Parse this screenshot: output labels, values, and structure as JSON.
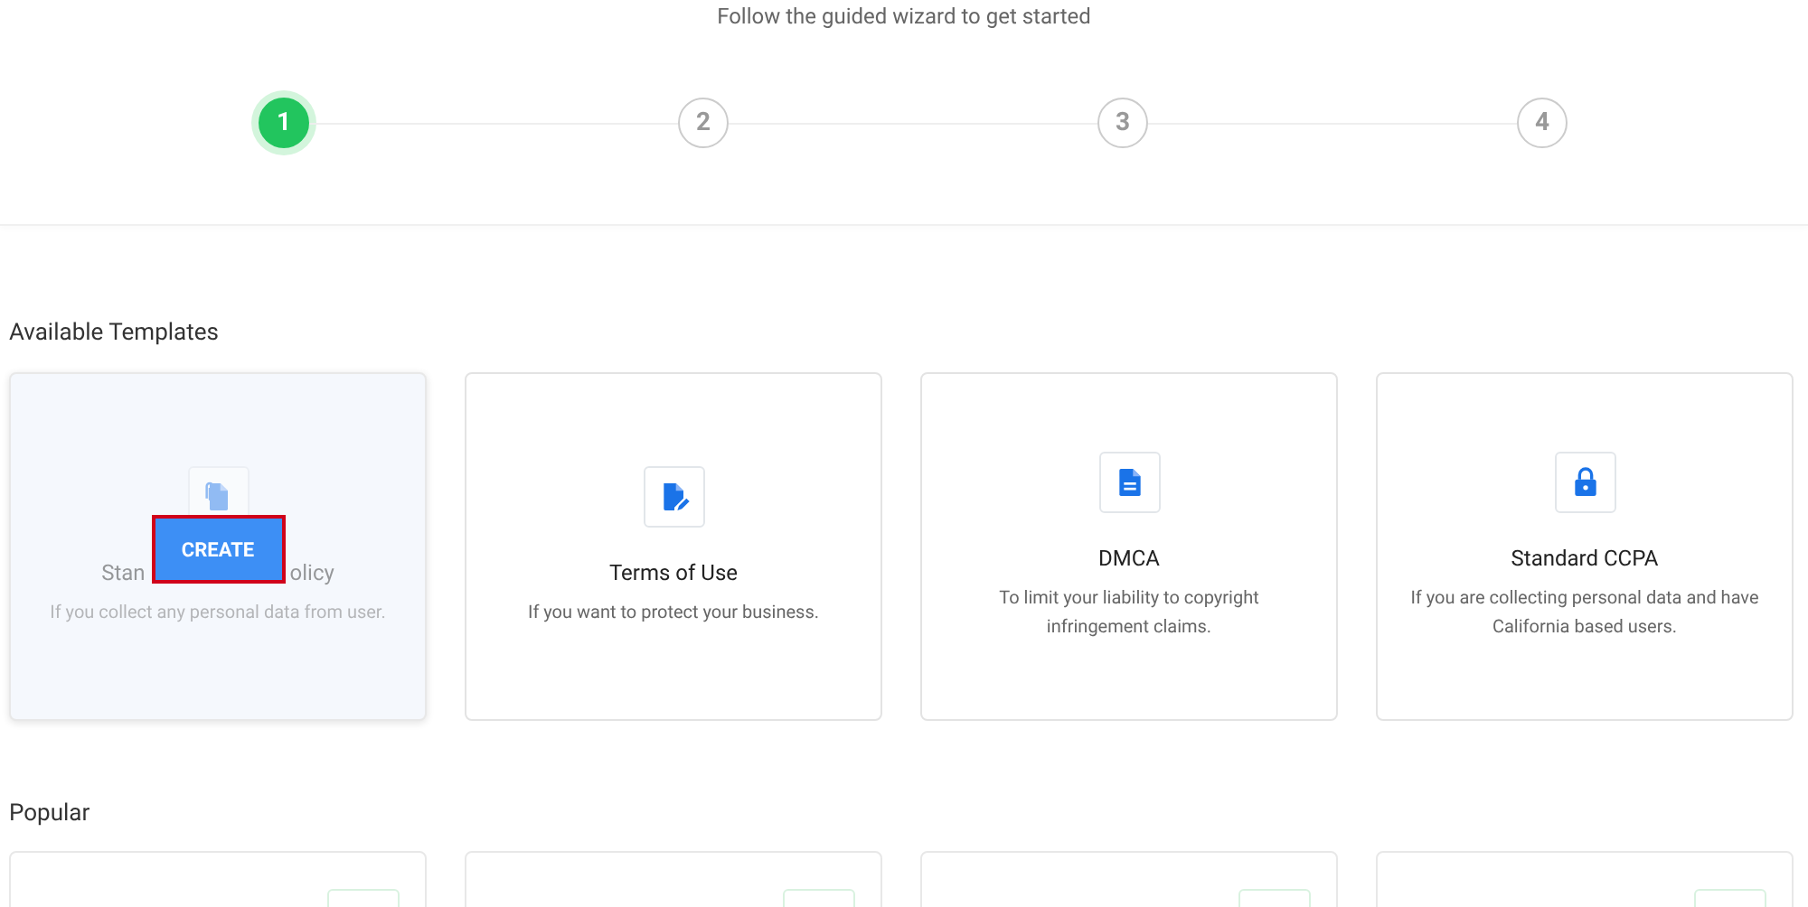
{
  "subtitle": "Follow the guided wizard to get started",
  "steps": [
    {
      "label": "1",
      "selected": true
    },
    {
      "label": "2",
      "selected": false
    },
    {
      "label": "3",
      "selected": false
    },
    {
      "label": "4",
      "selected": false
    }
  ],
  "available": {
    "title": "Available Templates",
    "cards": [
      {
        "hovered": true,
        "title_parts": [
          "Stan",
          "olicy"
        ],
        "description": "If you collect any personal data from user.",
        "action": {
          "label": "CREATE",
          "highlighted": true
        }
      },
      {
        "hovered": false,
        "title_parts": [
          "Terms of Use"
        ],
        "description": "If you want to protect your business."
      },
      {
        "hovered": false,
        "title_parts": [
          "DMCA"
        ],
        "description": "To limit your liability to copyright infringement claims."
      },
      {
        "hovered": false,
        "title_parts": [
          "Standard CCPA"
        ],
        "description": "If you are collecting personal data and have California based users."
      }
    ]
  },
  "popular": {
    "title": "Popular"
  }
}
